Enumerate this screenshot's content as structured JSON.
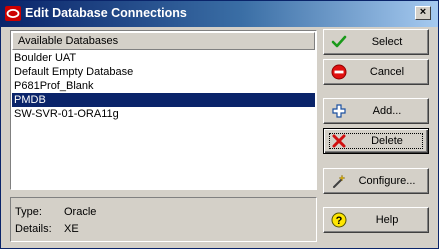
{
  "window": {
    "title": "Edit Database Connections",
    "close_glyph": "×"
  },
  "list": {
    "header": "Available Databases",
    "items": [
      {
        "label": "Boulder UAT",
        "selected": false
      },
      {
        "label": "Default Empty Database",
        "selected": false
      },
      {
        "label": "P681Prof_Blank",
        "selected": false
      },
      {
        "label": "PMDB",
        "selected": true
      },
      {
        "label": "SW-SVR-01-ORA11g",
        "selected": false
      }
    ]
  },
  "details": {
    "type_label": "Type:",
    "type_value": "Oracle",
    "details_label": "Details:",
    "details_value": "XE"
  },
  "buttons": {
    "select": "Select",
    "cancel": "Cancel",
    "add": "Add...",
    "delete": "Delete",
    "configure": "Configure...",
    "help": "Help"
  },
  "icons": {
    "app": "oracle-logo-icon",
    "select": "green-check-icon",
    "cancel": "red-no-entry-icon",
    "add": "blue-plus-icon",
    "delete": "red-x-icon",
    "configure": "magic-wand-icon",
    "help": "yellow-question-icon"
  },
  "colors": {
    "title_bar_start": "#0a246a",
    "title_bar_end": "#a6caf0",
    "selection": "#0a246a",
    "face": "#d4d0c8"
  }
}
